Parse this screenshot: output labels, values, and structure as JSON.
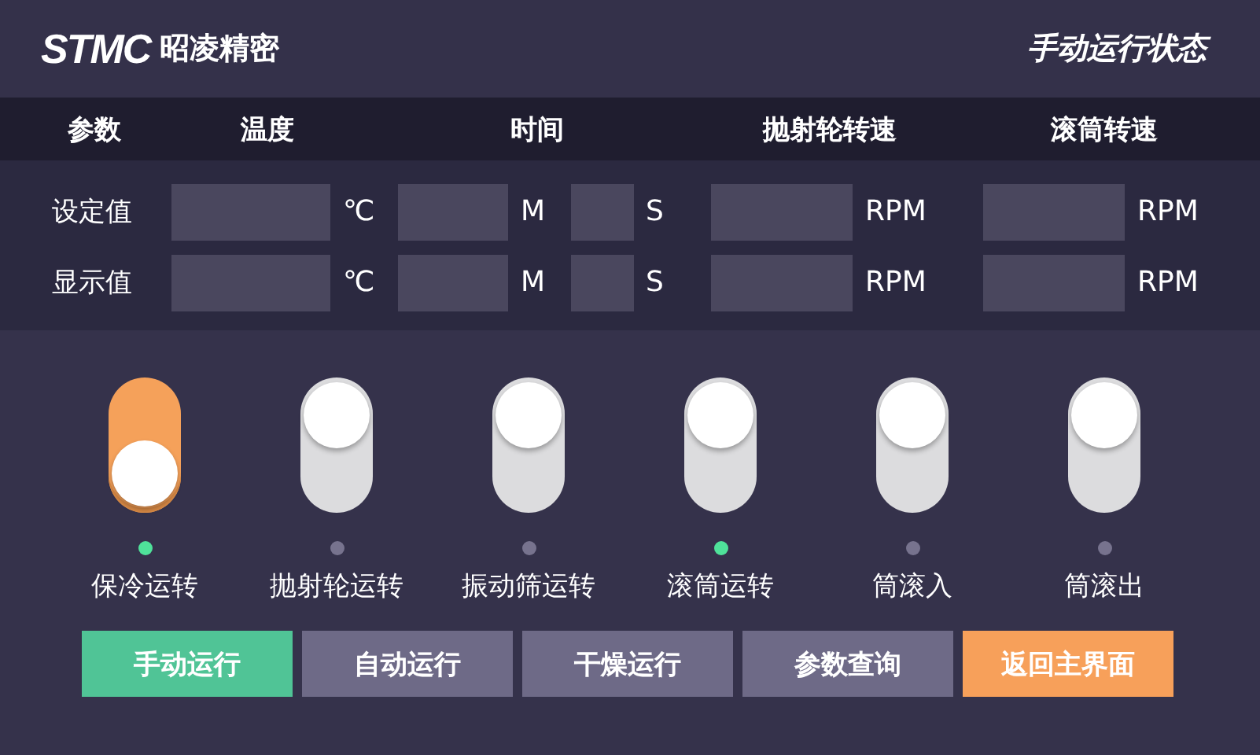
{
  "header": {
    "logo": "STMC",
    "brand": "昭凌精密",
    "title": "手动运行状态"
  },
  "table": {
    "columns": [
      "参数",
      "温度",
      "时间",
      "抛射轮转速",
      "滚筒转速"
    ],
    "rows": [
      {
        "cells": [
          {
            "text": "设定值"
          },
          {
            "fields": [
              {
                "unit": "℃"
              }
            ]
          },
          {
            "fields": [
              {
                "unit": "M"
              },
              {
                "unit": "S"
              }
            ]
          },
          {
            "fields": [
              {
                "unit": "RPM"
              }
            ]
          },
          {
            "fields": [
              {
                "unit": "RPM"
              }
            ]
          }
        ]
      },
      {
        "cells": [
          {
            "text": "显示值"
          },
          {
            "fields": [
              {
                "unit": "℃"
              }
            ]
          },
          {
            "fields": [
              {
                "unit": "M"
              },
              {
                "unit": "S"
              }
            ]
          },
          {
            "fields": [
              {
                "unit": "RPM"
              }
            ]
          },
          {
            "fields": [
              {
                "unit": "RPM"
              }
            ]
          }
        ]
      }
    ]
  },
  "switches": [
    {
      "label": "保冷运转",
      "on": true,
      "running": true
    },
    {
      "label": "抛射轮运转",
      "on": false,
      "running": false
    },
    {
      "label": "振动筛运转",
      "on": false,
      "running": false
    },
    {
      "label": "滚筒运转",
      "on": false,
      "running": true
    },
    {
      "label": "筒滚入",
      "on": false,
      "running": false
    },
    {
      "label": "筒滚出",
      "on": false,
      "running": false
    }
  ],
  "buttons": [
    {
      "label": "手动运行",
      "kind": "mode",
      "selected": true
    },
    {
      "label": "自动运行",
      "kind": "mode",
      "selected": false
    },
    {
      "label": "干燥运行",
      "kind": "mode",
      "selected": false
    },
    {
      "label": "参数查询",
      "kind": "mode",
      "selected": false
    },
    {
      "label": "返回主界面",
      "kind": "back",
      "selected": false
    }
  ]
}
